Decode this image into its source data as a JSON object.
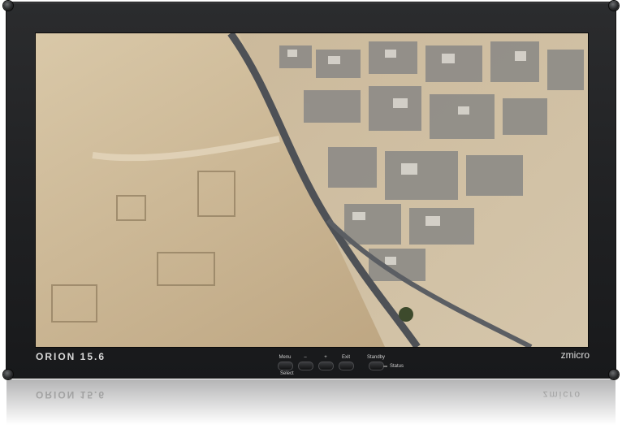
{
  "monitor": {
    "model": "ORION 15.6",
    "maker": "zmicro",
    "buttons": [
      {
        "label": "Menu"
      },
      {
        "label": "–"
      },
      {
        "label": "+"
      },
      {
        "label": "Exit"
      },
      {
        "label": "Standby"
      }
    ],
    "select_label": "Select",
    "status_label": "Status"
  },
  "screen": {
    "content": "aerial-desert-village-photo",
    "colors": {
      "sand": "#c9b48f",
      "road": "#4e5156",
      "houses": "#8c8a86"
    }
  }
}
